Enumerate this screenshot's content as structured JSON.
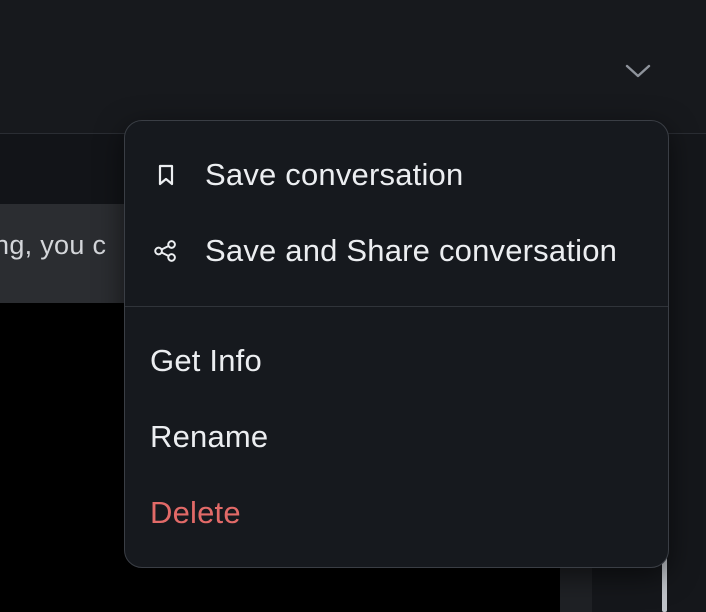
{
  "header": {
    "chevron_icon": "chevron-down-icon"
  },
  "background": {
    "message_fragment": "ng, you c"
  },
  "menu": {
    "items": [
      {
        "label": "Save conversation",
        "icon": "bookmark-icon"
      },
      {
        "label": "Save and Share conversation",
        "icon": "share-icon"
      },
      {
        "label": "Get Info"
      },
      {
        "label": "Rename"
      },
      {
        "label": "Delete",
        "color": "#e26a68"
      }
    ]
  }
}
